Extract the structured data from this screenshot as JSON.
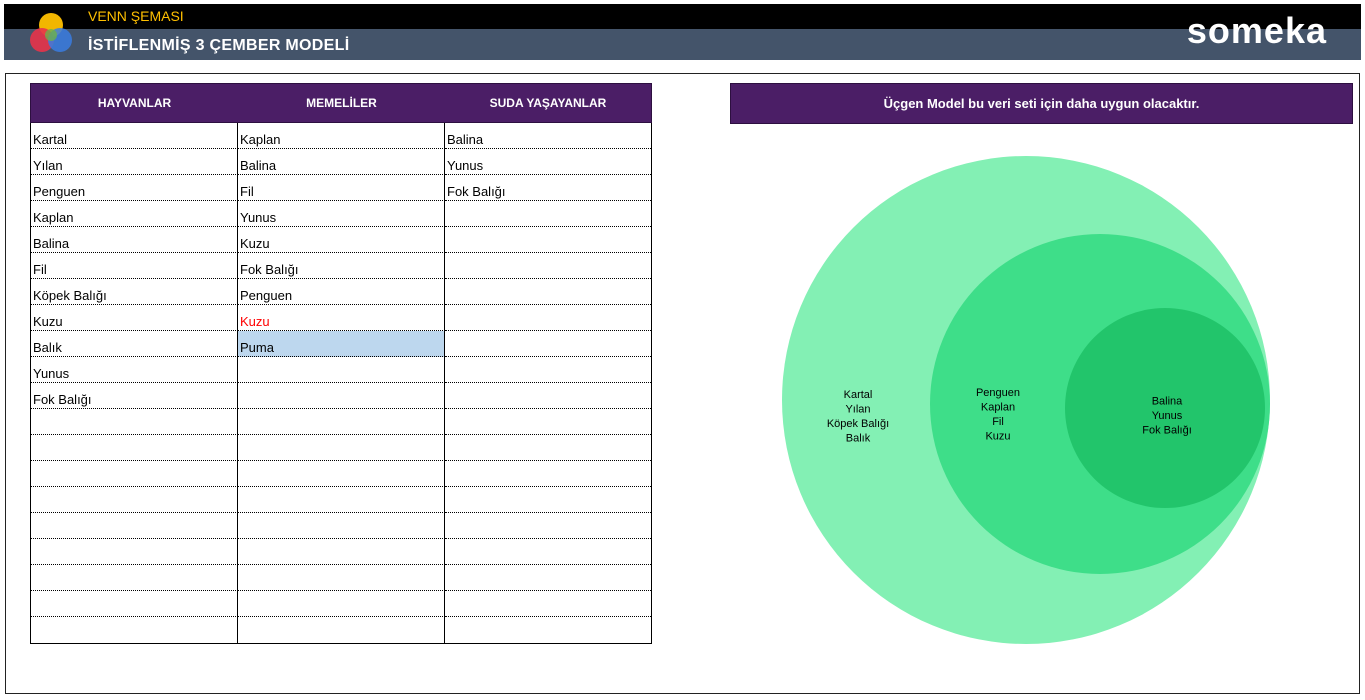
{
  "header": {
    "subtitle": "VENN ŞEMASI",
    "title": "İSTİFLENMİŞ 3 ÇEMBER MODELİ",
    "brand": "someka"
  },
  "colors": {
    "header_black": "#000000",
    "header_slate": "#44546a",
    "subtitle_gold": "#ffc000",
    "table_header_purple": "#4b1e66",
    "outer_circle": "#83f0b4",
    "middle_circle": "#3ede89",
    "inner_circle": "#22c56b",
    "highlight_cell": "#bdd7ee",
    "error_text": "#ff0000"
  },
  "table": {
    "headers": [
      "HAYVANLAR",
      "MEMELİLER",
      "SUDA YAŞAYANLAR"
    ],
    "rows": [
      [
        "Kartal",
        "Kaplan",
        "Balina"
      ],
      [
        "Yılan",
        "Balina",
        "Yunus"
      ],
      [
        "Penguen",
        "Fil",
        "Fok Balığı"
      ],
      [
        "Kaplan",
        "Yunus",
        ""
      ],
      [
        "Balina",
        "Kuzu",
        ""
      ],
      [
        "Fil",
        "Fok Balığı",
        ""
      ],
      [
        "Köpek Balığı",
        "Penguen",
        ""
      ],
      [
        "Kuzu",
        "Kuzu",
        ""
      ],
      [
        "Balık",
        "Puma",
        ""
      ],
      [
        "Yunus",
        "",
        ""
      ],
      [
        "Fok Balığı",
        "",
        ""
      ],
      [
        "",
        "",
        ""
      ],
      [
        "",
        "",
        ""
      ],
      [
        "",
        "",
        ""
      ],
      [
        "",
        "",
        ""
      ],
      [
        "",
        "",
        ""
      ],
      [
        "",
        "",
        ""
      ],
      [
        "",
        "",
        ""
      ],
      [
        "",
        "",
        ""
      ],
      [
        "",
        "",
        ""
      ]
    ],
    "red_cells": [
      [
        7,
        1
      ]
    ],
    "highlight_cells": [
      [
        8,
        1
      ]
    ]
  },
  "note": "Üçgen Model bu veri seti için daha uygun olacaktır.",
  "venn": {
    "outer_only": [
      "Kartal",
      "Yılan",
      "Köpek Balığı",
      "Balık"
    ],
    "middle_only": [
      "Penguen",
      "Kaplan",
      "Fil",
      "Kuzu"
    ],
    "inner": [
      "Balina",
      "Yunus",
      "Fok Balığı"
    ]
  }
}
